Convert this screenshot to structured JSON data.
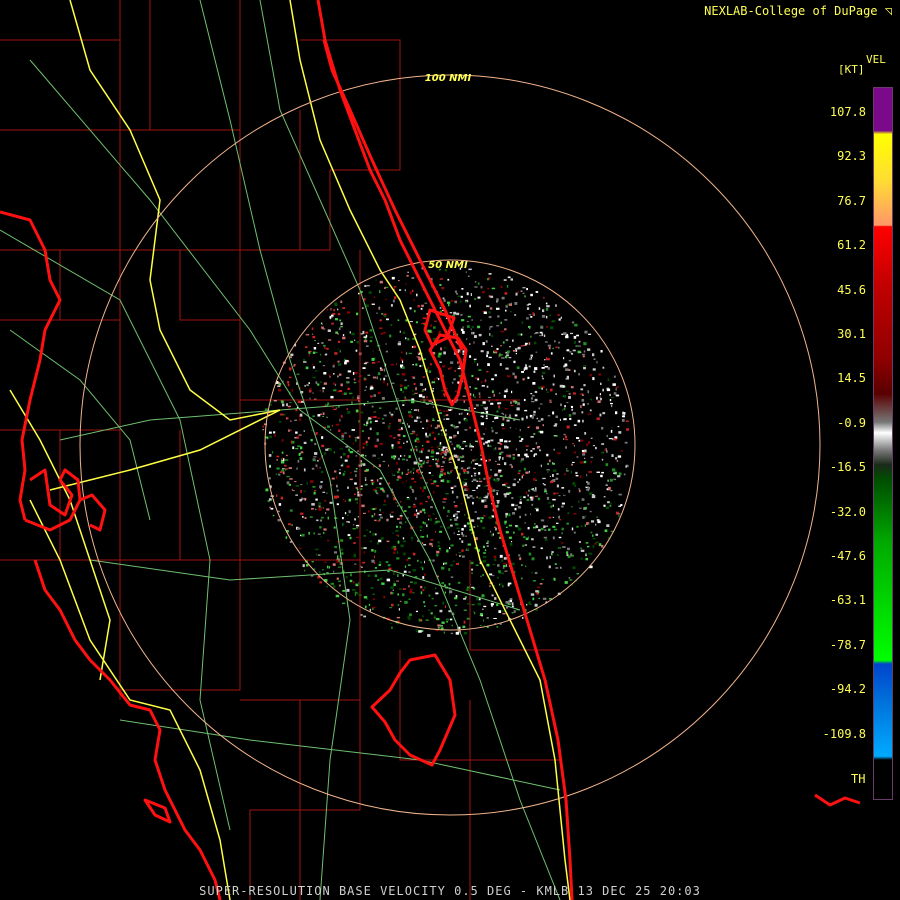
{
  "credit": "NEXLAB-College of DuPage",
  "credit_icon": "corner-arrow-icon",
  "legend": {
    "product": "VEL",
    "unit": "[KT]",
    "ticks": [
      "107.8",
      "92.3",
      "76.7",
      "61.2",
      "45.6",
      "30.1",
      "14.5",
      "-0.9",
      "-16.5",
      "-32.0",
      "-47.6",
      "-63.1",
      "-78.7",
      "-94.2",
      "-109.8"
    ],
    "bottom_label": "TH",
    "colors": {
      "purple": "#7a0a8a",
      "yellow": "#ffff00",
      "salmon": "#ff9966",
      "red": "#ff0000",
      "darkred": "#5a0000",
      "white": "#ffffff",
      "gray": "#777777",
      "darkgreen": "#004d00",
      "green": "#00ff00",
      "blue": "#0044cc",
      "cyan": "#00aaff"
    }
  },
  "rings": [
    "50 NMI",
    "100 NMI"
  ],
  "footer": "SUPER-RESOLUTION BASE VELOCITY 0.5 DEG - KMLB 13 DEC 25 20:03",
  "map_colors": {
    "coast": "#ff1111",
    "county": "#aa1111",
    "highway": "#ffff44",
    "road": "#7fd07f",
    "ring": "#f2b48c"
  }
}
